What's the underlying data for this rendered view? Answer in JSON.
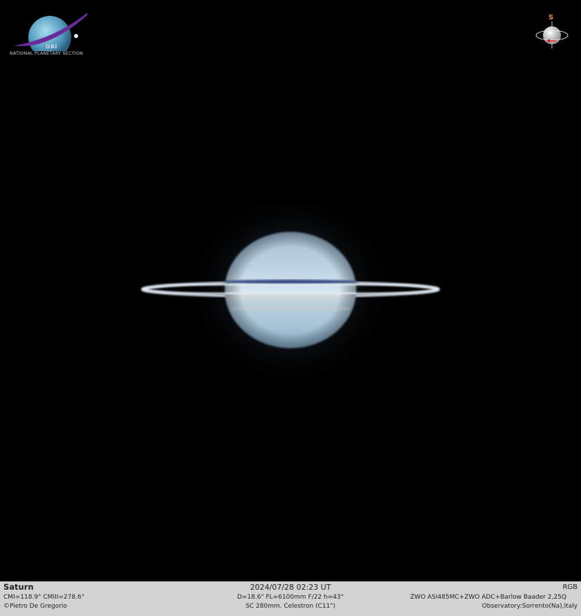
{
  "logo": {
    "acronym": "UAI",
    "section": "NATIONAL PLANETARY SECTION",
    "colors": {
      "planet": "#5aa7c9",
      "ring": "#6a2a9a"
    }
  },
  "orientation": {
    "south_label": "S",
    "arrow_color": "#e0201c"
  },
  "caption": {
    "object": "Saturn",
    "cm": "CMI=118.9° CMIII=278.6°",
    "author": "©Pietro De Gregorio",
    "datetime": "2024/07/28   02:23 UT",
    "optics": "D=18.6\" FL=6100mm F/22 h=43°",
    "telescope": "SC 280mm. Celestron (C11\")",
    "filter": "RGB",
    "camera": "ZWO ASI485MC+ZWO ADC+Barlow Baader 2,25Q",
    "observatory": "Observatory:Sorrento(Na),Italy"
  }
}
